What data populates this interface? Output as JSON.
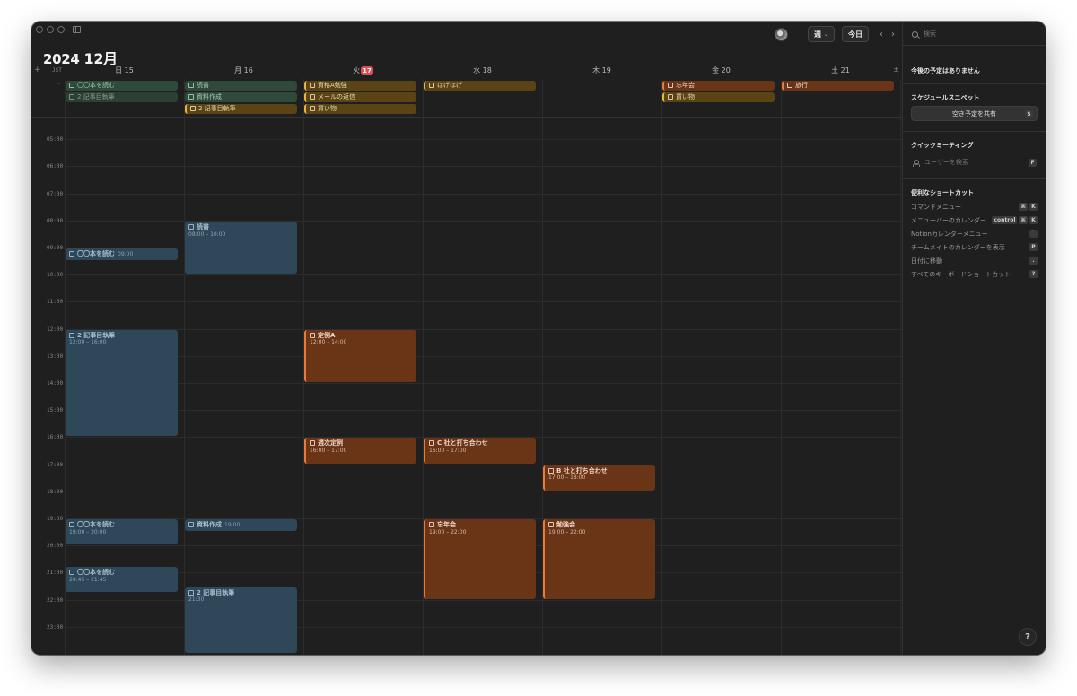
{
  "header": {
    "year": "2024",
    "month": "12月",
    "view_label": "週",
    "today_label": "今日",
    "prev_icon": "‹",
    "next_icon": "›"
  },
  "calendar": {
    "timezone": "JST",
    "days": [
      {
        "dow": "日",
        "num": "15"
      },
      {
        "dow": "月",
        "num": "16"
      },
      {
        "dow": "火",
        "num": "17",
        "today": true
      },
      {
        "dow": "水",
        "num": "18"
      },
      {
        "dow": "木",
        "num": "19"
      },
      {
        "dow": "金",
        "num": "20"
      },
      {
        "dow": "土",
        "num": "21"
      }
    ],
    "hours": [
      "05:00",
      "06:00",
      "07:00",
      "08:00",
      "09:00",
      "10:00",
      "11:00",
      "12:00",
      "13:00",
      "14:00",
      "15:00",
      "16:00",
      "17:00",
      "18:00",
      "19:00",
      "20:00",
      "21:00",
      "22:00",
      "23:00"
    ],
    "allday_events": [
      {
        "day": 0,
        "row": 0,
        "title": "〇〇本を読む",
        "style": "green"
      },
      {
        "day": 0,
        "row": 1,
        "title": "2 記事目執筆",
        "style": "green",
        "dim": true
      },
      {
        "day": 1,
        "row": 0,
        "title": "読書",
        "style": "green"
      },
      {
        "day": 1,
        "row": 1,
        "title": "資料作成",
        "style": "green"
      },
      {
        "day": 1,
        "row": 2,
        "title": "2 記事目執筆",
        "style": "yellow"
      },
      {
        "day": 2,
        "row": 0,
        "title": "資格A勉強",
        "style": "yellow"
      },
      {
        "day": 2,
        "row": 1,
        "title": "メールの返信",
        "style": "yellow"
      },
      {
        "day": 2,
        "row": 2,
        "title": "買い物",
        "style": "yellow"
      },
      {
        "day": 3,
        "row": 0,
        "title": "ほげほげ",
        "style": "yellow"
      },
      {
        "day": 5,
        "row": 0,
        "title": "忘年会",
        "style": "orange"
      },
      {
        "day": 5,
        "row": 1,
        "title": "買い物",
        "style": "yellow"
      },
      {
        "day": 6,
        "row": 0,
        "title": "旅行",
        "style": "orange"
      }
    ],
    "timed_events": [
      {
        "day": 1,
        "start": 8.0,
        "end": 10.0,
        "title": "読書",
        "time": "08:00 – 10:00",
        "style": "blue"
      },
      {
        "day": 0,
        "start": 9.0,
        "end": 9.5,
        "title": "〇〇本を読む",
        "time": "09:00",
        "style": "blue",
        "inline": true
      },
      {
        "day": 0,
        "start": 12.0,
        "end": 16.0,
        "title": "2 記事目執筆",
        "time": "12:00 – 16:00",
        "style": "blue"
      },
      {
        "day": 2,
        "start": 12.0,
        "end": 14.0,
        "title": "定例A",
        "time": "12:00 – 14:00",
        "style": "orange"
      },
      {
        "day": 2,
        "start": 16.0,
        "end": 17.0,
        "title": "週次定例",
        "time": "16:00 – 17:00",
        "style": "orange"
      },
      {
        "day": 3,
        "start": 16.0,
        "end": 17.0,
        "title": "C 社と打ち合わせ",
        "time": "16:00 – 17:00",
        "style": "orange"
      },
      {
        "day": 4,
        "start": 17.0,
        "end": 18.0,
        "title": "B 社と打ち合わせ",
        "time": "17:00 – 18:00",
        "style": "orange"
      },
      {
        "day": 0,
        "start": 19.0,
        "end": 20.0,
        "title": "〇〇本を読む",
        "time": "19:00 – 20:00",
        "style": "blue"
      },
      {
        "day": 1,
        "start": 19.0,
        "end": 19.5,
        "title": "資料作成",
        "time": "19:00",
        "style": "blue",
        "inline": true
      },
      {
        "day": 3,
        "start": 19.0,
        "end": 22.0,
        "title": "忘年会",
        "time": "19:00 – 22:00",
        "style": "orange"
      },
      {
        "day": 4,
        "start": 19.0,
        "end": 22.0,
        "title": "勉強会",
        "time": "19:00 – 22:00",
        "style": "orange"
      },
      {
        "day": 0,
        "start": 20.75,
        "end": 21.75,
        "title": "〇〇本を読む",
        "time": "20:45 – 21:45",
        "style": "blue"
      },
      {
        "day": 1,
        "start": 21.5,
        "end": 24.0,
        "title": "2 記事目執筆",
        "time": "21:30",
        "style": "blue"
      }
    ]
  },
  "panel": {
    "search_placeholder": "検索",
    "upcoming": "今後の予定はありません",
    "snippet_title": "スケジュールスニペット",
    "share_label": "空き予定を共有",
    "share_key": "S",
    "quick_title": "クイックミーティング",
    "user_search": "ユーザーを検索",
    "user_search_key": "F",
    "shortcuts_title": "便利なショートカット",
    "shortcuts": [
      {
        "label": "コマンドメニュー",
        "keys": [
          "⌘",
          "K"
        ]
      },
      {
        "label": "メニューバーのカレンダー",
        "keys": [
          "control",
          "⌘",
          "K"
        ]
      },
      {
        "label": "Notionカレンダーメニュー",
        "keys": [
          "`"
        ]
      },
      {
        "label": "チームメイトのカレンダーを表示",
        "keys": [
          "P"
        ]
      },
      {
        "label": "日付に移動",
        "keys": [
          "."
        ]
      },
      {
        "label": "すべてのキーボードショートカット",
        "keys": [
          "?"
        ]
      }
    ]
  },
  "help_label": "?",
  "colors": {
    "green_bg": "#2f4a3a",
    "yellow_bg": "#5a4416",
    "orange_bg": "#6a3417",
    "blue_bg": "#2e4759",
    "today_badge": "#e5484d"
  }
}
